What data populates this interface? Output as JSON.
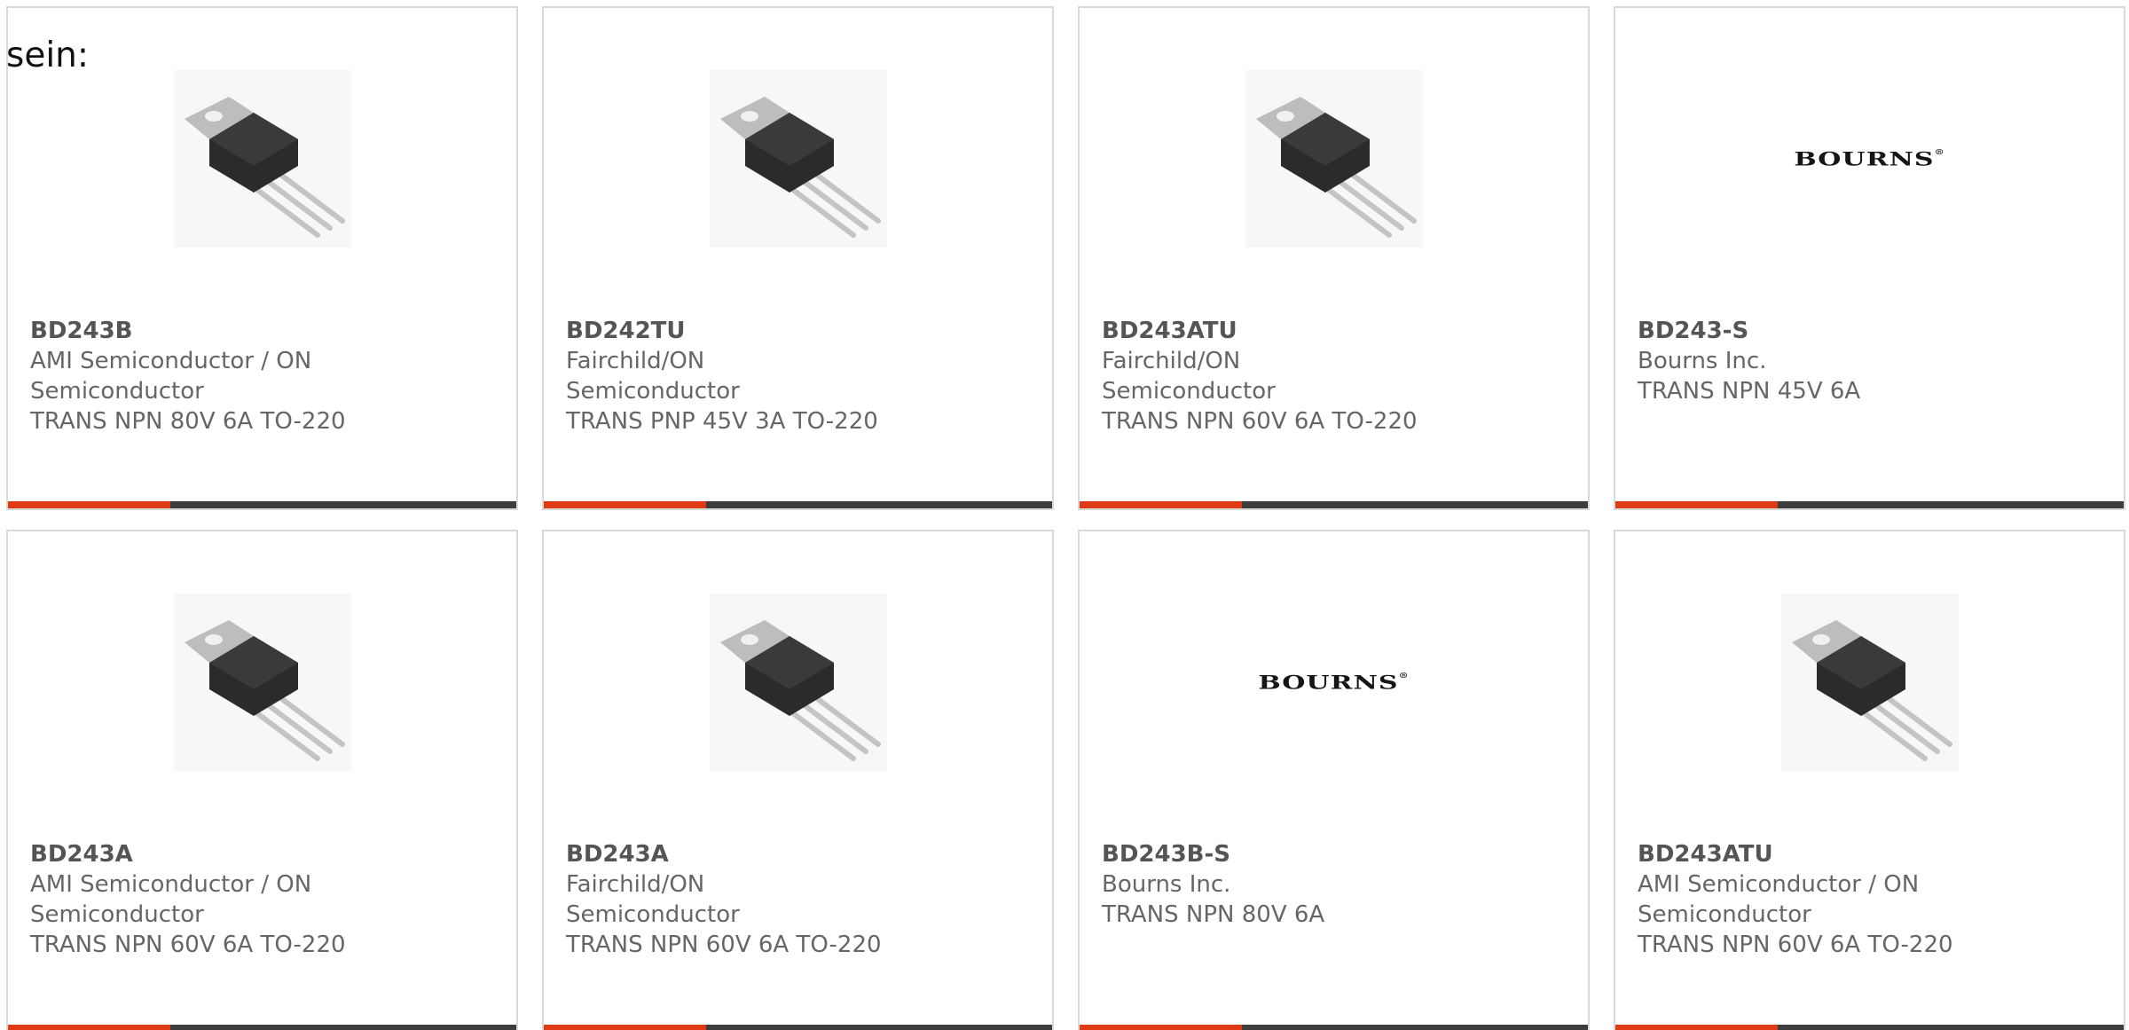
{
  "intro_text": "sein:",
  "colors": {
    "accent": "#e03a14",
    "bar": "#3d3d3d",
    "border": "#d9d9d9",
    "text": "#666666"
  },
  "cards": [
    {
      "part": "BD243B",
      "maker_line1": "AMI Semiconductor / ON",
      "maker_line2": "Semiconductor",
      "desc": "TRANS NPN 80V 6A TO-220",
      "image": "to220-transistor-icon"
    },
    {
      "part": "BD242TU",
      "maker_line1": "Fairchild/ON Semiconductor",
      "maker_line2": "",
      "desc": "TRANS PNP 45V 3A TO-220",
      "image": "to220-transistor-icon"
    },
    {
      "part": "BD243ATU",
      "maker_line1": "Fairchild/ON Semiconductor",
      "maker_line2": "",
      "desc": "TRANS NPN 60V 6A TO-220",
      "image": "to220-transistor-icon"
    },
    {
      "part": "BD243-S",
      "maker_line1": "Bourns Inc.",
      "maker_line2": "",
      "desc": "TRANS NPN 45V 6A",
      "image": "bourns-logo",
      "logo_text": "BOURNS"
    },
    {
      "part": "BD243A",
      "maker_line1": "AMI Semiconductor / ON",
      "maker_line2": "Semiconductor",
      "desc": "TRANS NPN 60V 6A TO-220",
      "image": "to220-transistor-icon"
    },
    {
      "part": "BD243A",
      "maker_line1": "Fairchild/ON Semiconductor",
      "maker_line2": "",
      "desc": "TRANS NPN 60V 6A TO-220",
      "image": "to220-transistor-icon"
    },
    {
      "part": "BD243B-S",
      "maker_line1": "Bourns Inc.",
      "maker_line2": "",
      "desc": "TRANS NPN 80V 6A",
      "image": "bourns-logo",
      "logo_text": "BOURNS"
    },
    {
      "part": "BD243ATU",
      "maker_line1": "AMI Semiconductor / ON",
      "maker_line2": "Semiconductor",
      "desc": "TRANS NPN 60V 6A TO-220",
      "image": "to220-transistor-icon"
    }
  ]
}
